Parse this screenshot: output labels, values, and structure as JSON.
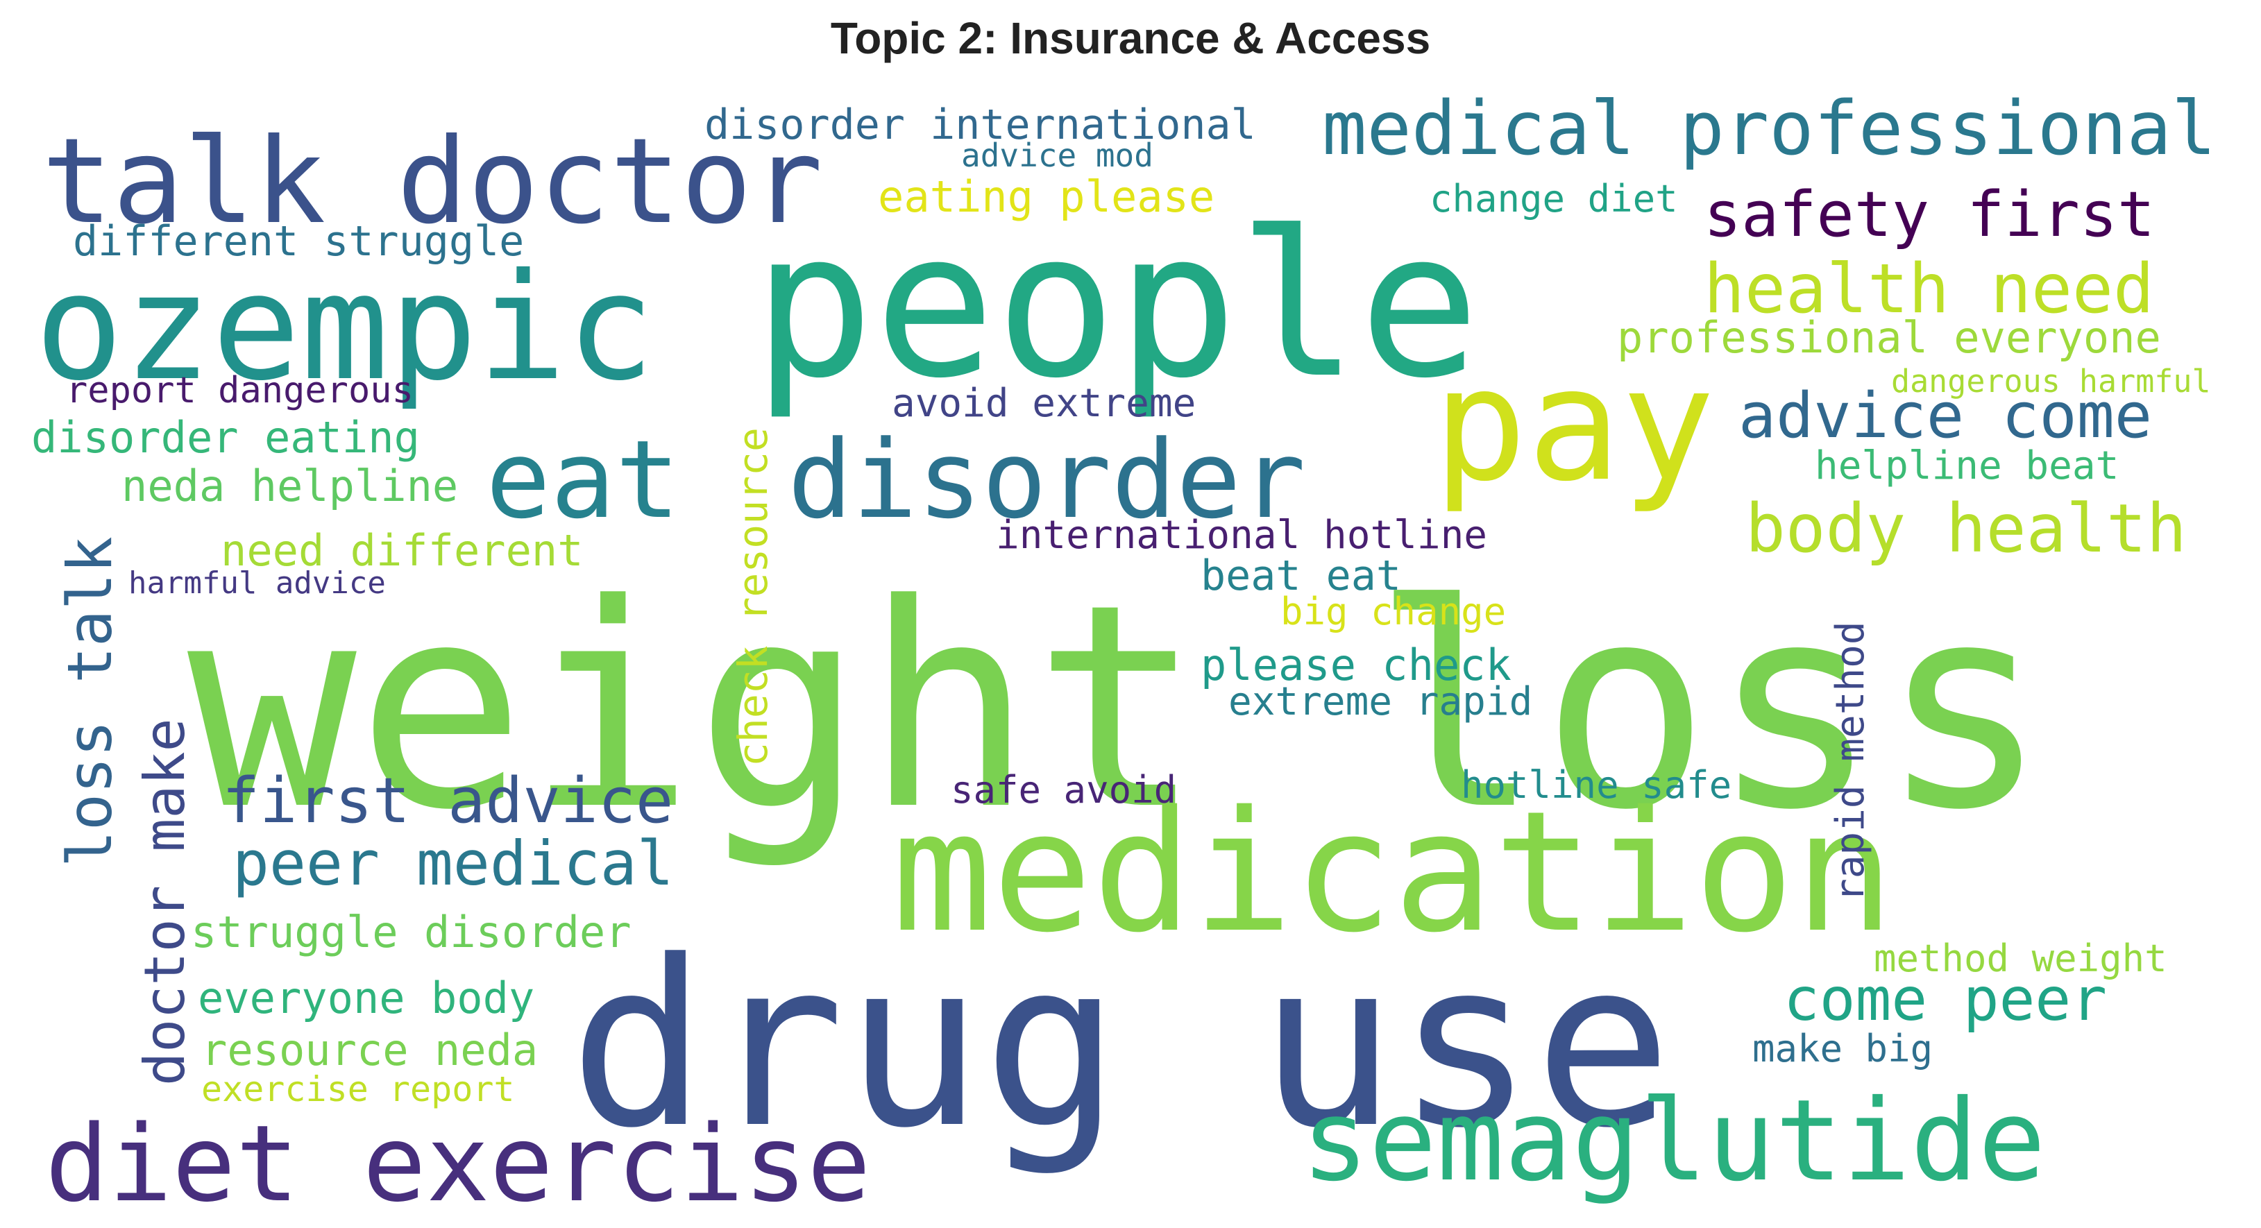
{
  "chart_data": {
    "type": "wordcloud",
    "title": "Topic 2: Insurance & Access",
    "words": [
      {
        "text": "weight loss",
        "color": "#7ad151"
      },
      {
        "text": "people",
        "color": "#22a884"
      },
      {
        "text": "drug use",
        "color": "#3b528b"
      },
      {
        "text": "medication",
        "color": "#86d549"
      },
      {
        "text": "ozempic",
        "color": "#21918c"
      },
      {
        "text": "pay",
        "color": "#d0e11c"
      },
      {
        "text": "talk doctor",
        "color": "#3b528b"
      },
      {
        "text": "disorder",
        "color": "#2c728e"
      },
      {
        "text": "eat",
        "color": "#26828e"
      },
      {
        "text": "semaglutide",
        "color": "#2ab07f"
      },
      {
        "text": "diet exercise",
        "color": "#472f7d"
      },
      {
        "text": "medical professional",
        "color": "#2a788e"
      },
      {
        "text": "safety first",
        "color": "#440154"
      },
      {
        "text": "health need",
        "color": "#bddf26"
      },
      {
        "text": "advice come",
        "color": "#31688e"
      },
      {
        "text": "body health",
        "color": "#b5de2b"
      },
      {
        "text": "first advice",
        "color": "#39568c"
      },
      {
        "text": "peer medical",
        "color": "#2a788e"
      },
      {
        "text": "come peer",
        "color": "#20a486"
      },
      {
        "text": "loss talk",
        "color": "#33638d"
      },
      {
        "text": "doctor make",
        "color": "#3e4a89"
      },
      {
        "text": "check resource",
        "color": "#c2df23"
      },
      {
        "text": "rapid method",
        "color": "#3e4989"
      },
      {
        "text": "disorder international",
        "color": "#31688e"
      },
      {
        "text": "different struggle",
        "color": "#2c728e"
      },
      {
        "text": "eating please",
        "color": "#e2e418"
      },
      {
        "text": "professional everyone",
        "color": "#9dd93b"
      },
      {
        "text": "disorder eating",
        "color": "#35b779"
      },
      {
        "text": "neda helpline",
        "color": "#5ec962"
      },
      {
        "text": "need different",
        "color": "#a5db36"
      },
      {
        "text": "struggle disorder",
        "color": "#6ccd5a"
      },
      {
        "text": "everyone body",
        "color": "#2fb47c"
      },
      {
        "text": "resource neda",
        "color": "#7ad151"
      },
      {
        "text": "exercise report",
        "color": "#c0df25"
      },
      {
        "text": "report dangerous",
        "color": "#481a6c"
      },
      {
        "text": "harmful advice",
        "color": "#443983"
      },
      {
        "text": "advice mod",
        "color": "#2c728e"
      },
      {
        "text": "change diet",
        "color": "#20a386"
      },
      {
        "text": "dangerous harmful",
        "color": "#a8db34"
      },
      {
        "text": "helpline beat",
        "color": "#3bbb75"
      },
      {
        "text": "avoid extreme",
        "color": "#414487"
      },
      {
        "text": "international hotline",
        "color": "#481f70"
      },
      {
        "text": "beat eat",
        "color": "#26828e"
      },
      {
        "text": "big change",
        "color": "#d8e219"
      },
      {
        "text": "please check",
        "color": "#1f9a8a"
      },
      {
        "text": "extreme rapid",
        "color": "#277f8e"
      },
      {
        "text": "safe avoid",
        "color": "#482576"
      },
      {
        "text": "hotline safe",
        "color": "#228c8d"
      },
      {
        "text": "method weight",
        "color": "#95d840"
      },
      {
        "text": "make big",
        "color": "#2e6f8e"
      }
    ]
  }
}
